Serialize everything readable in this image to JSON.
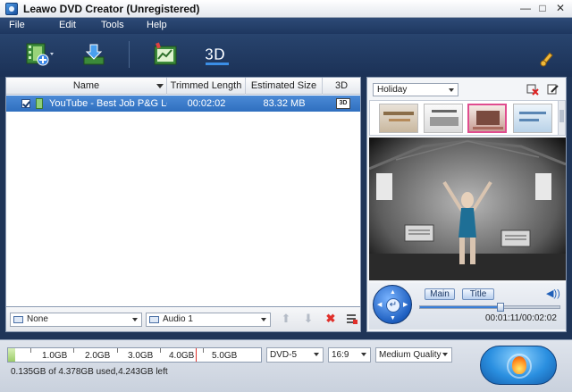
{
  "window": {
    "title": "Leawo DVD Creator (Unregistered)",
    "minimize": "—",
    "maximize": "□",
    "close": "✕"
  },
  "menu": [
    "File",
    "Edit",
    "Tools",
    "Help"
  ],
  "toolbar": {
    "add_video_icon": "add-video-icon",
    "load_icon": "download-icon",
    "edit_icon": "edit-video-icon",
    "threed_label": "3D",
    "settings_icon": "wrench-icon"
  },
  "table": {
    "columns": [
      "Name",
      "Trimmed Length",
      "Estimated Size",
      "3D"
    ],
    "rows": [
      {
        "name": "YouTube - Best Job  P&G Lo...",
        "trimmed_length": "00:02:02",
        "estimated_size": "83.32 MB",
        "threed_icon": "3d-off"
      }
    ]
  },
  "left_bottom": {
    "subtitle": "None",
    "audio": "Audio 1"
  },
  "menu_panel": {
    "theme": "Holiday",
    "main_button": "Main",
    "title_button": "Title",
    "time": "00:01:11/00:02:02",
    "progress": 0.58
  },
  "bottom": {
    "capacity_labels": [
      "1.0GB",
      "2.0GB",
      "3.0GB",
      "4.0GB",
      "5.0GB"
    ],
    "used_fraction": 0.0286,
    "disc_type": "DVD-5",
    "aspect": "16:9",
    "quality": "Medium Quality",
    "usage_text": "0.135GB of 4.378GB used,4.243GB left"
  },
  "colors": {
    "accent": "#2f6fbf",
    "chrome": "#1f3558",
    "limit": "#e0302b"
  }
}
